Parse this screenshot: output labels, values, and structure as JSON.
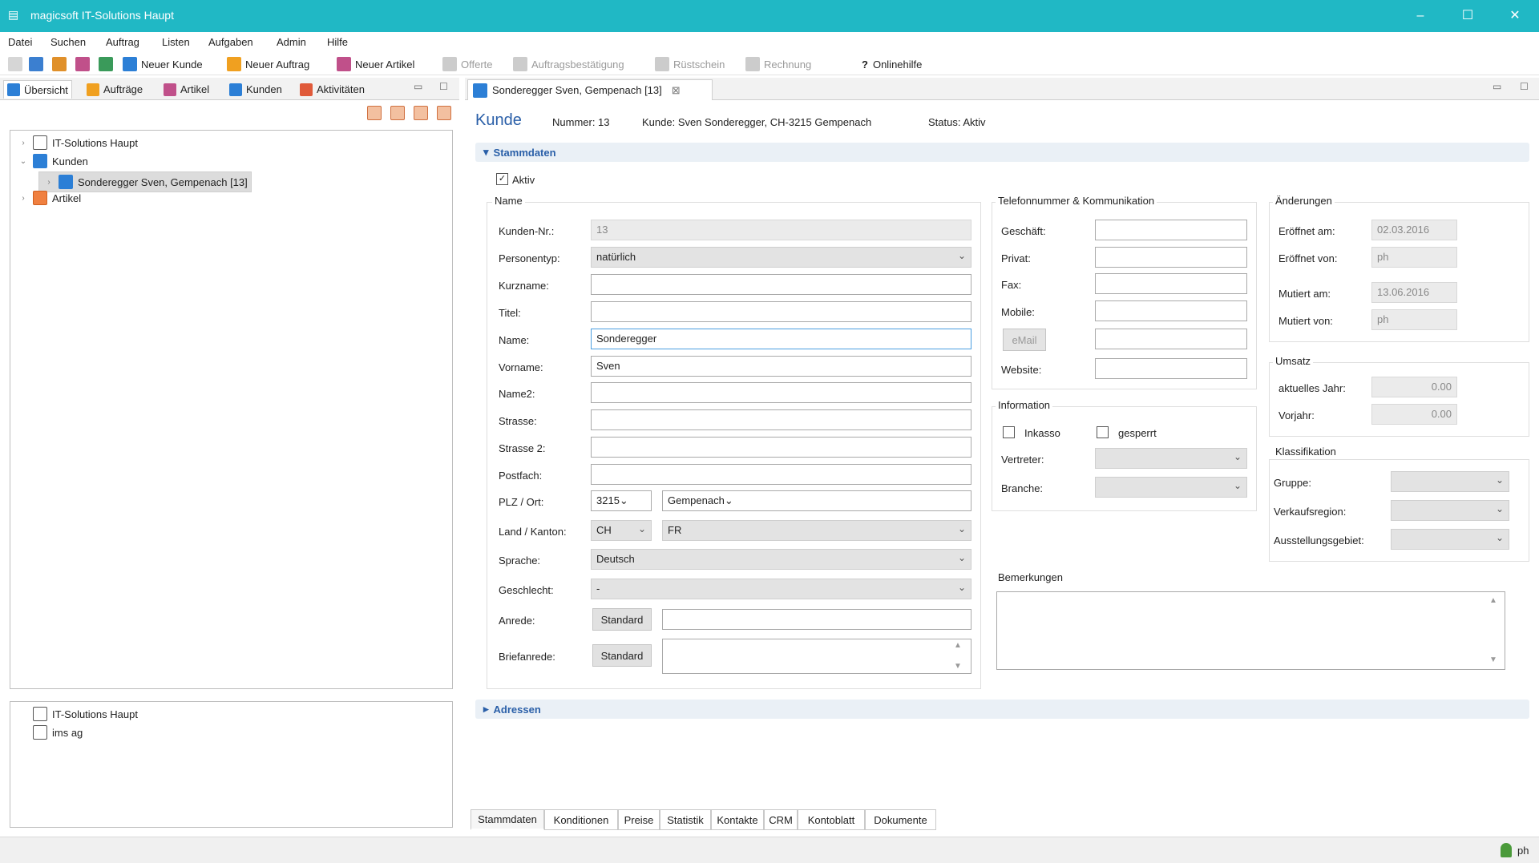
{
  "window": {
    "title": "magicsoft IT-Solutions Haupt",
    "app_icon": "app-icon",
    "accent": "#20b8c5"
  },
  "menu": [
    "Datei",
    "Suchen",
    "Auftrag",
    "Listen",
    "Aufgaben",
    "Admin",
    "Hilfe"
  ],
  "toolbar": {
    "new_customer": "Neuer Kunde",
    "new_order": "Neuer Auftrag",
    "new_article": "Neuer Artikel",
    "offer": "Offerte",
    "order_confirmation": "Auftragsbestätigung",
    "delivery_note": "Rüstschein",
    "invoice": "Rechnung",
    "online_help_icon": "?",
    "online_help": "Onlinehilfe"
  },
  "left_tabs": [
    "Übersicht",
    "Aufträge",
    "Artikel",
    "Kunden",
    "Aktivitäten"
  ],
  "tree": {
    "root": "IT-Solutions Haupt",
    "customers": "Kunden",
    "selected_customer": "Sonderegger Sven, Gempenach [13]",
    "articles": "Artikel"
  },
  "tree2": [
    "IT-Solutions Haupt",
    "ims ag"
  ],
  "editor_tab": "Sonderegger Sven, Gempenach [13]",
  "header": {
    "title": "Kunde",
    "number": "Nummer: 13",
    "customer": "Kunde: Sven Sonderegger, CH-3215 Gempenach",
    "status": "Status: Aktiv"
  },
  "stammdaten": {
    "section": "Stammdaten",
    "active_label": "Aktiv",
    "name_group": "Name",
    "fields": {
      "kunden_nr_label": "Kunden-Nr.:",
      "kunden_nr": "13",
      "personentyp_label": "Personentyp:",
      "personentyp": "natürlich",
      "kurzname_label": "Kurzname:",
      "kurzname": "",
      "titel_label": "Titel:",
      "titel": "",
      "name_label": "Name:",
      "name": "Sonderegger",
      "vorname_label": "Vorname:",
      "vorname": "Sven",
      "name2_label": "Name2:",
      "name2": "",
      "strasse_label": "Strasse:",
      "strasse": "",
      "strasse2_label": "Strasse 2:",
      "strasse2": "",
      "postfach_label": "Postfach:",
      "postfach": "",
      "plz_ort_label": "PLZ / Ort:",
      "plz": "3215",
      "ort": "Gempenach",
      "land_kanton_label": "Land / Kanton:",
      "land": "CH",
      "kanton": "FR",
      "sprache_label": "Sprache:",
      "sprache": "Deutsch",
      "geschlecht_label": "Geschlecht:",
      "geschlecht": "-",
      "anrede_label": "Anrede:",
      "anrede_button": "Standard",
      "anrede": "",
      "briefanrede_label": "Briefanrede:",
      "briefanrede_button": "Standard",
      "briefanrede": ""
    },
    "telefon": {
      "group": "Telefonnummer & Kommunikation",
      "geschaeft_label": "Geschäft:",
      "privat_label": "Privat:",
      "fax_label": "Fax:",
      "mobile_label": "Mobile:",
      "email_button": "eMail",
      "website_label": "Website:"
    },
    "information": {
      "group": "Information",
      "inkasso": "Inkasso",
      "gesperrt": "gesperrt",
      "vertreter_label": "Vertreter:",
      "branche_label": "Branche:"
    },
    "aenderungen": {
      "group": "Änderungen",
      "eroeffnet_am_label": "Eröffnet am:",
      "eroeffnet_am": "02.03.2016",
      "eroeffnet_von_label": "Eröffnet von:",
      "eroeffnet_von": "ph",
      "mutiert_am_label": "Mutiert am:",
      "mutiert_am": "13.06.2016",
      "mutiert_von_label": "Mutiert von:",
      "mutiert_von": "ph"
    },
    "umsatz": {
      "group": "Umsatz",
      "aktuelles_jahr_label": "aktuelles Jahr:",
      "aktuelles_jahr": "0.00",
      "vorjahr_label": "Vorjahr:",
      "vorjahr": "0.00"
    },
    "klassifikation": {
      "group": "Klassifikation",
      "gruppe_label": "Gruppe:",
      "verkaufsregion_label": "Verkaufsregion:",
      "ausstellungsgebiet_label": "Ausstellungsgebiet:"
    },
    "bemerkungen": {
      "group": "Bemerkungen",
      "value": ""
    }
  },
  "adressen": {
    "section": "Adressen"
  },
  "bottom_tabs": [
    "Stammdaten",
    "Konditionen",
    "Preise",
    "Statistik",
    "Kontakte",
    "CRM",
    "Kontoblatt",
    "Dokumente"
  ],
  "status": {
    "user": "ph"
  }
}
